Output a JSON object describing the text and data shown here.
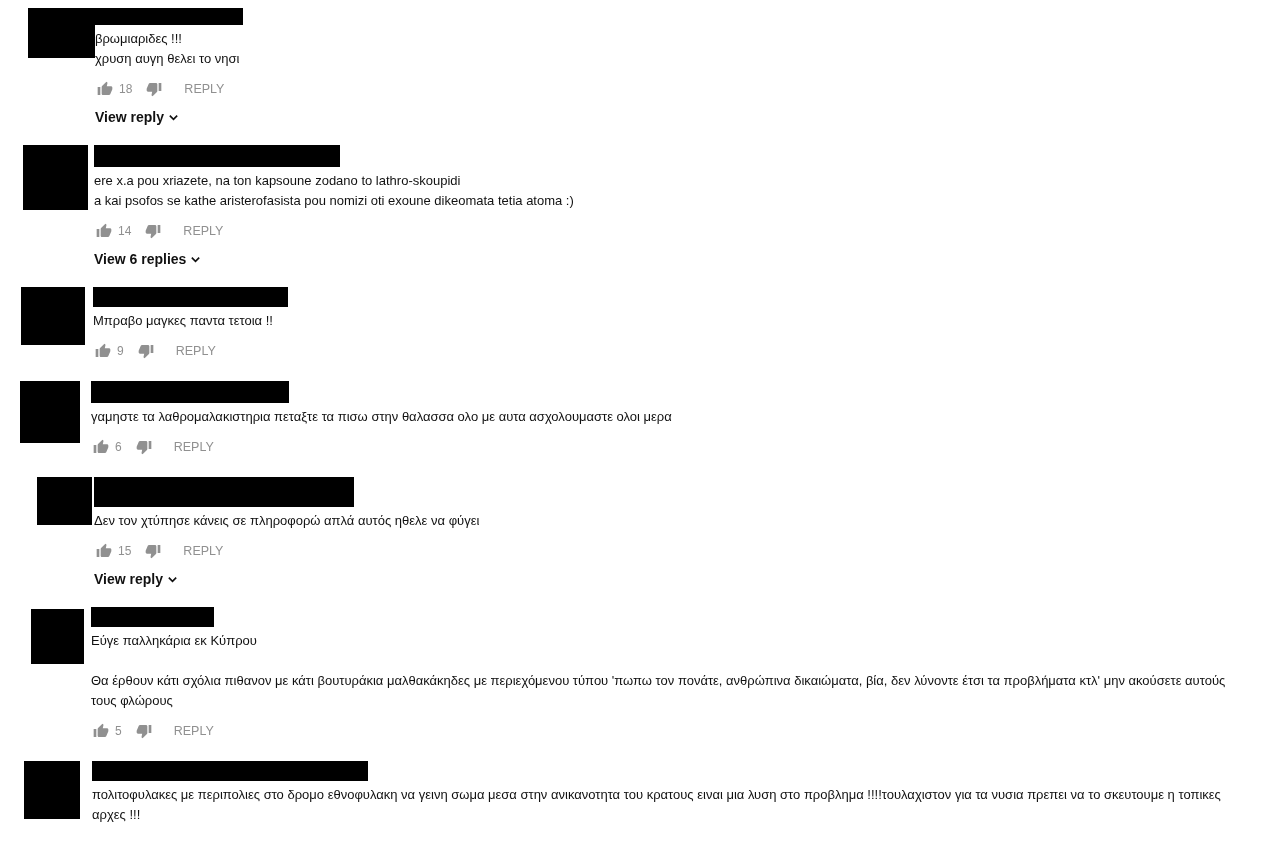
{
  "comments": [
    {
      "paragraphs": [
        [
          "βρωμιαριδες !!!",
          "χρυση αυγη θελει το νησι"
        ]
      ],
      "likes": "18",
      "reply": "REPLY",
      "view_replies": "View reply"
    },
    {
      "paragraphs": [
        [
          "ere x.a pou xriazete, na ton kapsoune zodano to lathro-skoupidi",
          "a kai psofos se kathe aristerofasista pou nomizi oti exoune dikeomata tetia atoma :)"
        ]
      ],
      "likes": "14",
      "reply": "REPLY",
      "view_replies": "View 6 replies"
    },
    {
      "paragraphs": [
        [
          "Μπραβο μαγκες παντα τετοια !!"
        ]
      ],
      "likes": "9",
      "reply": "REPLY"
    },
    {
      "paragraphs": [
        [
          "γαμηστε τα λαθρομαλακιστηρια πεταξτε τα πισω στην θαλασσα ολο με αυτα ασχολουμαστε ολοι μερα"
        ]
      ],
      "likes": "6",
      "reply": "REPLY"
    },
    {
      "paragraphs": [
        [
          "Δεν τον χτύπησε κάνεις σε πληροφορώ απλά αυτός ηθελε να φύγει"
        ]
      ],
      "likes": "15",
      "reply": "REPLY",
      "view_replies": "View reply"
    },
    {
      "paragraphs": [
        [
          "Εύγε παλληκάρια εκ Κύπρου"
        ],
        [
          "Θα έρθουν κάτι σχόλια πιθανον με κάτι βουτυράκια μαλθακάκηδες με περιεχόμενου τύπου 'πωπω τον πονάτε, ανθρώπινα δικαιώματα, βία, δεν λύνοντε έτσι τα προβλήματα κτλ' μην ακούσετε αυτούς τους φλώρους"
        ]
      ],
      "likes": "5",
      "reply": "REPLY"
    },
    {
      "paragraphs": [
        [
          "πολιτοφυλακες  με περιπολιες στο δρομο εθνοφυλακη να γεινη σωμα  μεσα στην ανικανοτητα του κρατους ειναι μια λυση στο προβλημα !!!!τουλαχιστον για τα νυσια πρεπει να το σκευτουμε η τοπικες αρχες !!!"
        ]
      ]
    }
  ]
}
